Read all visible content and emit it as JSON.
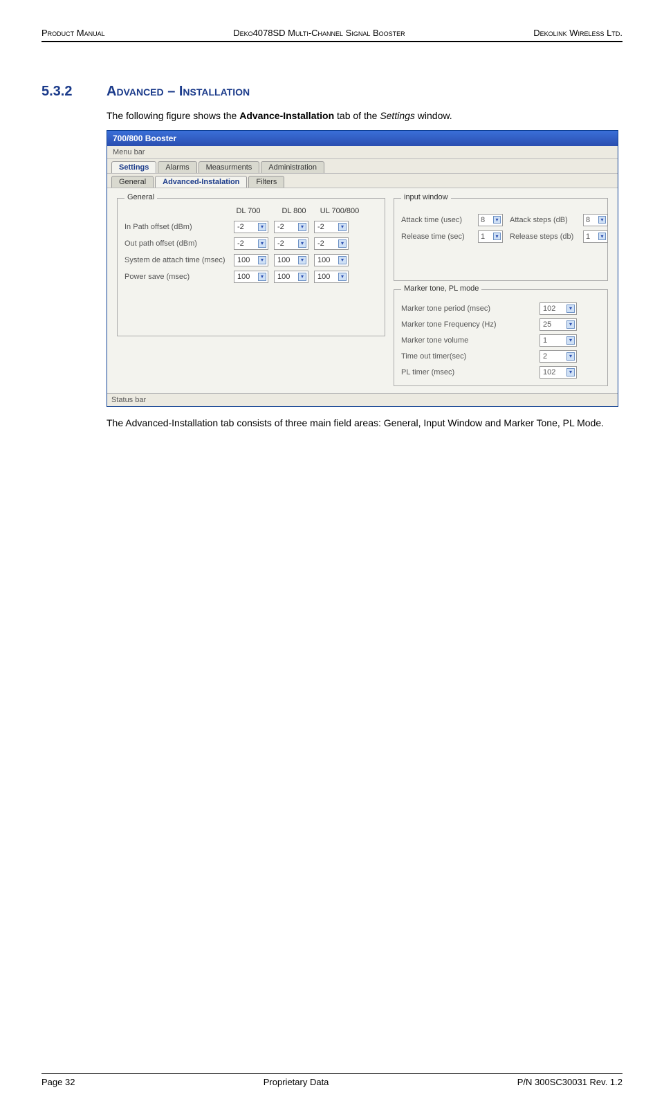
{
  "header": {
    "left": "Product Manual",
    "center": "Deko4078SD Multi-Channel Signal Booster",
    "right": "Dekolink Wireless Ltd."
  },
  "section": {
    "number": "5.3.2",
    "title": "Advanced – Installation"
  },
  "intro": {
    "pre": "The following figure shows the ",
    "bold": "Advance-Installation",
    "mid": " tab of the ",
    "ital": "Settings",
    "post": " window."
  },
  "outro": "The Advanced-Installation tab consists of three main field areas: General, Input Window and Marker Tone, PL Mode.",
  "footer": {
    "left": "Page 32",
    "center": "Proprietary Data",
    "right": "P/N 300SC30031 Rev. 1.2"
  },
  "win": {
    "title": "700/800 Booster",
    "menubar": "Menu bar",
    "statusbar": "Status bar",
    "maintabs": [
      "Settings",
      "Alarms",
      "Measurments",
      "Administration"
    ],
    "maintabs_active": 0,
    "subtabs": [
      "General",
      "Advanced-Instalation",
      "Filters"
    ],
    "subtabs_active": 1,
    "general": {
      "legend": "General",
      "cols": [
        "DL 700",
        "DL 800",
        "UL 700/800"
      ],
      "rows": [
        {
          "label": "In Path offset   (dBm)",
          "vals": [
            "-2",
            "-2",
            "-2"
          ]
        },
        {
          "label": "Out path offset (dBm)",
          "vals": [
            "-2",
            "-2",
            "-2"
          ]
        },
        {
          "label": "System de attach time (msec)",
          "vals": [
            "100",
            "100",
            "100"
          ]
        },
        {
          "label": "Power save (msec)",
          "vals": [
            "100",
            "100",
            "100"
          ]
        }
      ]
    },
    "inputwin": {
      "legend": "input window",
      "attack_time_lbl": "Attack time (usec)",
      "attack_time_val": "8",
      "attack_steps_lbl": "Attack steps (dB)",
      "attack_steps_val": "8",
      "release_time_lbl": "Release time (sec)",
      "release_time_val": "1",
      "release_steps_lbl": "Release steps (db)",
      "release_steps_val": "1"
    },
    "marker": {
      "legend": "Marker tone, PL mode",
      "rows": [
        {
          "label": "Marker tone period (msec)",
          "val": "102"
        },
        {
          "label": "Marker tone Frequency (Hz)",
          "val": "25"
        },
        {
          "label": "Marker tone volume",
          "val": "1"
        },
        {
          "label": "Time out timer(sec)",
          "val": "2"
        },
        {
          "label": "PL timer (msec)",
          "val": "102"
        }
      ]
    }
  }
}
